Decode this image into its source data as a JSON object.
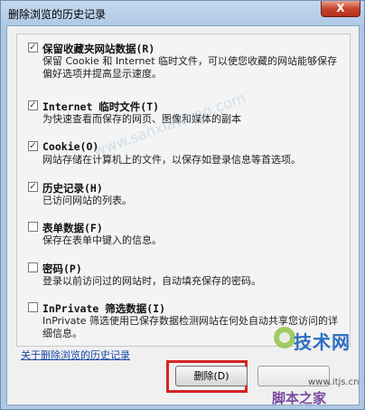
{
  "window": {
    "title": "删除浏览的历史记录",
    "close_label": "X"
  },
  "options": [
    {
      "title": "保留收藏夹网站数据(R)",
      "desc": "保留 Cookie 和 Internet 临时文件，可以使您收藏的网站能够保存偏好选项并提高显示速度。",
      "checked": true
    },
    {
      "title": "Internet 临时文件(T)",
      "desc": "为快速查看而保存的网页、图像和媒体的副本",
      "checked": true
    },
    {
      "title": "Cookie(O)",
      "desc": "网站存储在计算机上的文件，以保存如登录信息等首选项。",
      "checked": true
    },
    {
      "title": "历史记录(H)",
      "desc": "已访问网站的列表。",
      "checked": true
    },
    {
      "title": "表单数据(F)",
      "desc": "保存在表单中键入的信息。",
      "checked": false
    },
    {
      "title": "密码(P)",
      "desc": "登录以前访问过的网站时，自动填充保存的密码。",
      "checked": false
    },
    {
      "title": "InPrivate 筛选数据(I)",
      "desc": "InPrivate 筛选使用已保存数据检测网站在何处自动共享您访问的详细信息。",
      "checked": false
    }
  ],
  "footer": {
    "link_text": "关于删除浏览的历史记录",
    "delete_label": "删除(D)"
  },
  "watermark": {
    "brand": "技术网",
    "site": "www.itjs.cn",
    "jb": "脚本之家",
    "diag": "www.sanxiawang.com"
  },
  "colors": {
    "highlight": "#d62424",
    "link": "#1a47a8"
  }
}
